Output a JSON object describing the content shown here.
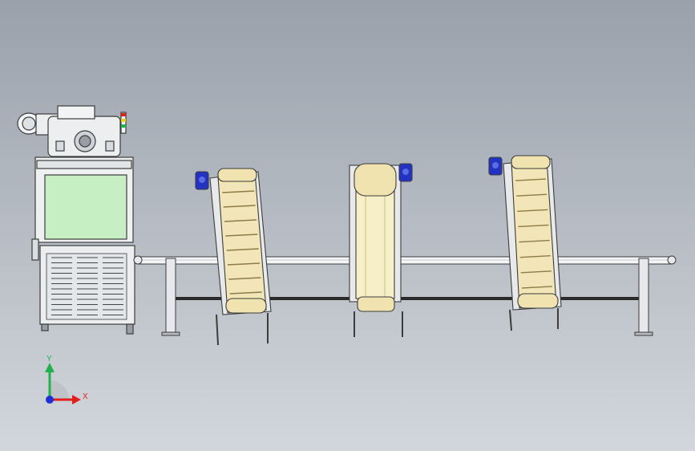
{
  "triad": {
    "x_label": "X",
    "y_label": "Y",
    "x_color": "#e0201c",
    "y_color": "#22b14c",
    "z_color": "#1f2fd6"
  },
  "colors": {
    "frame": "#e9ebee",
    "frame_stroke": "#3c3c3c",
    "panel": "#c6efc3",
    "belt": "#f2e6b8",
    "belt_dark": "#cdbd86",
    "motor": "#2233c4",
    "rail_dark": "#2a2a2a"
  },
  "components": [
    {
      "name": "machine"
    },
    {
      "name": "conveyor-1"
    },
    {
      "name": "conveyor-2"
    },
    {
      "name": "conveyor-3"
    },
    {
      "name": "rail"
    }
  ]
}
